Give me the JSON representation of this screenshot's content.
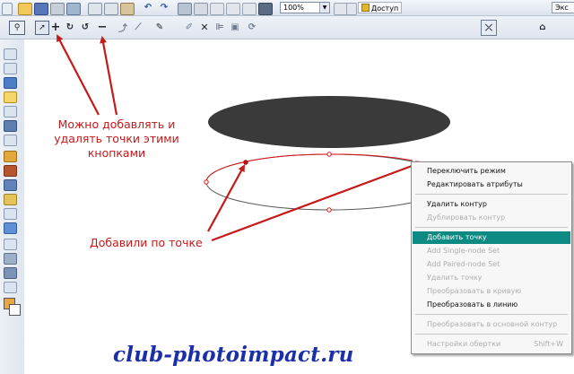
{
  "toolbar": {
    "zoom_value": "100%",
    "access_label": "Доступ",
    "export_label": "Экс"
  },
  "context_menu": {
    "items": [
      {
        "label": "Переключить режим",
        "state": "enabled"
      },
      {
        "label": "Редактировать атрибуты",
        "state": "enabled"
      },
      {
        "label": "Удалить контур",
        "state": "enabled"
      },
      {
        "label": "Дублировать контур",
        "state": "disabled"
      },
      {
        "label": "Добавить точку",
        "state": "highlighted"
      },
      {
        "label": "Add Single-node Set",
        "state": "disabled"
      },
      {
        "label": "Add Paired-node Set",
        "state": "disabled"
      },
      {
        "label": "Удалить точку",
        "state": "disabled"
      },
      {
        "label": "Преобразовать в кривую",
        "state": "disabled"
      },
      {
        "label": "Преобразовать в линию",
        "state": "enabled"
      },
      {
        "label": "Преобразовать в основной контур",
        "state": "disabled"
      },
      {
        "label": "Настройки обертки",
        "shortcut": "Shift+W",
        "state": "disabled"
      }
    ]
  },
  "annotations": {
    "buttons_note": [
      "Можно добавлять и",
      "удалять точки этими",
      "кнопками"
    ],
    "added_note": "Добавили по точке"
  },
  "watermark": "club-photoimpact.ru",
  "colors": {
    "annotation_red": "#c51a1a",
    "menu_highlight": "#0d8a82",
    "ellipse_fill": "#3a3a3a",
    "watermark_blue": "#1b2fa8"
  }
}
